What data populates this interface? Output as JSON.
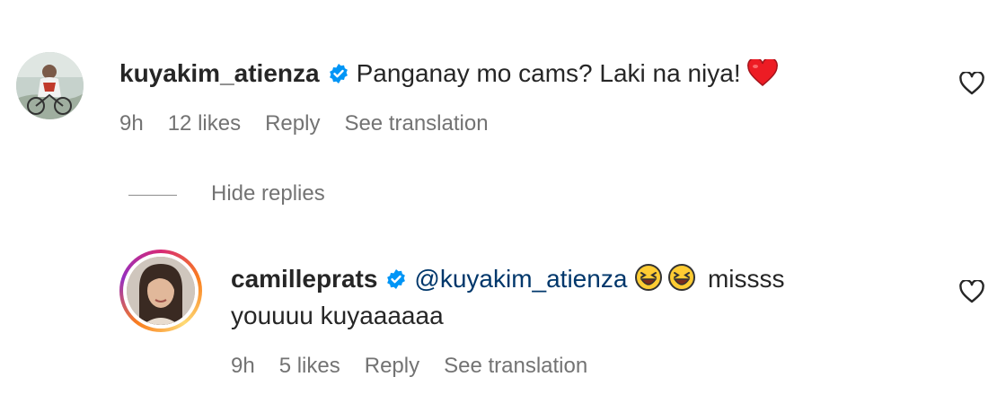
{
  "comments": [
    {
      "username": "kuyakim_atienza",
      "text": "Panganay mo cams? Laki na niya!",
      "emoji_trailing": "red-heart",
      "time": "9h",
      "likes": "12 likes",
      "reply": "Reply",
      "translate": "See translation"
    }
  ],
  "replies_toggle": "Hide replies",
  "replies": [
    {
      "username": "camilleprats",
      "mention": "@kuyakim_atienza",
      "text_line1_tail": "missss",
      "text_line2": "youuuu kuyaaaaaa",
      "emojis": [
        "laughing-face",
        "laughing-face"
      ],
      "time": "9h",
      "likes": "5 likes",
      "reply": "Reply",
      "translate": "See translation"
    }
  ],
  "colors": {
    "verified": "#0095f6",
    "mention": "#00376b",
    "secondary_text": "#737373",
    "heart": "#ed1c24"
  }
}
